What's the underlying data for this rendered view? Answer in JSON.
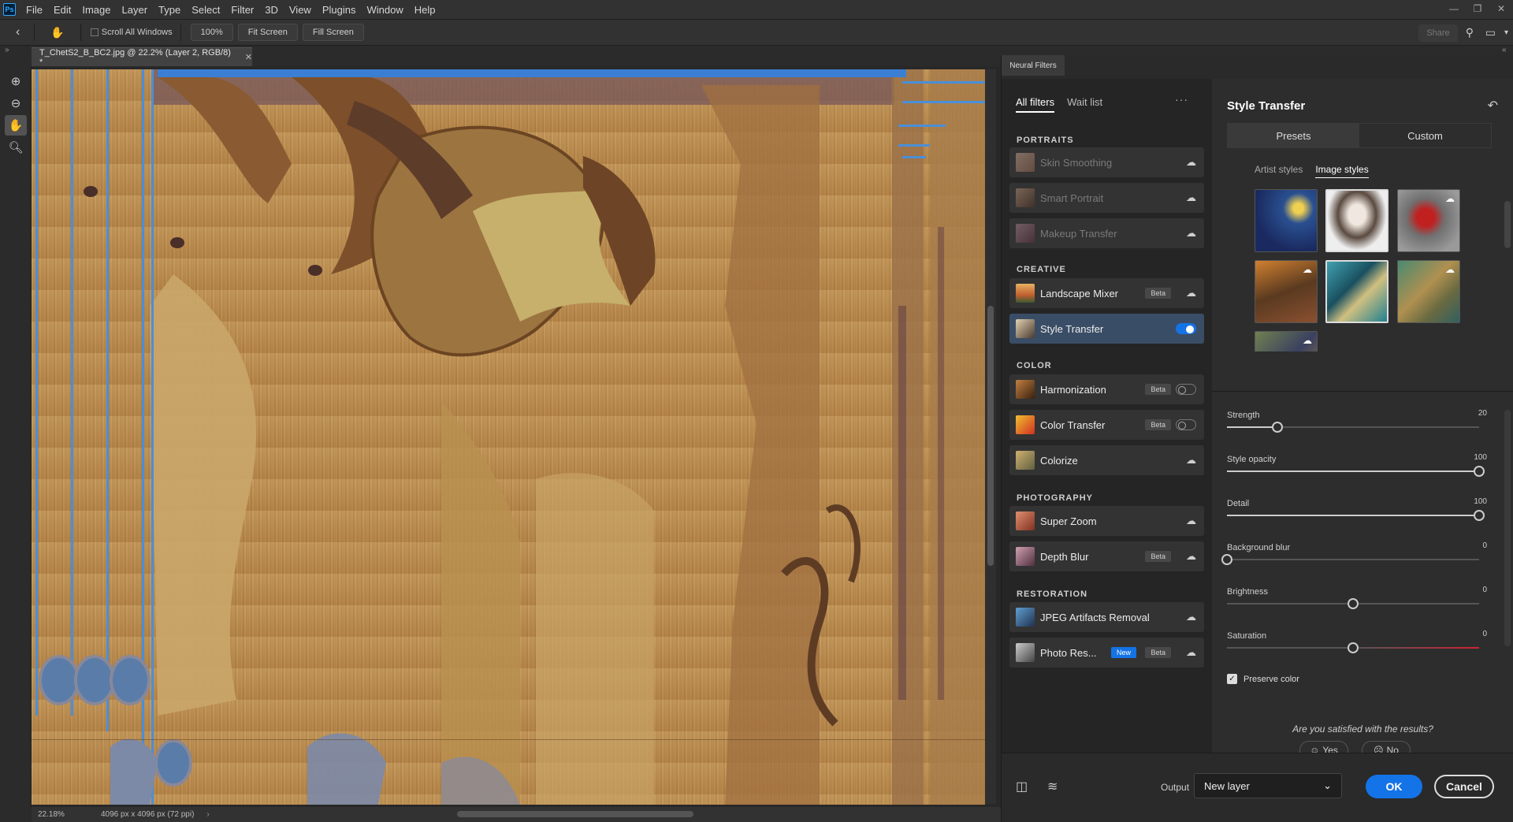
{
  "app": {
    "logo": "Ps"
  },
  "menu": [
    "File",
    "Edit",
    "Image",
    "Layer",
    "Type",
    "Select",
    "Filter",
    "3D",
    "View",
    "Plugins",
    "Window",
    "Help"
  ],
  "options": {
    "scroll_all_windows": "Scroll All Windows",
    "zoom_level": "100%",
    "fit_screen": "Fit Screen",
    "fill_screen": "Fill Screen",
    "share": "Share"
  },
  "document": {
    "tab_title": "T_ChetS2_B_BC2.jpg @ 22.2% (Layer 2, RGB/8) *",
    "zoom": "22.18%",
    "dimensions": "4096 px x 4096 px (72 ppi)"
  },
  "neural_filters": {
    "panel_tab": "Neural Filters",
    "tabs": [
      "All filters",
      "Wait list"
    ],
    "sections": {
      "portraits": "PORTRAITS",
      "creative": "CREATIVE",
      "color": "COLOR",
      "photography": "PHOTOGRAPHY",
      "restoration": "RESTORATION"
    },
    "filters": {
      "skin_smoothing": "Skin Smoothing",
      "smart_portrait": "Smart Portrait",
      "makeup_transfer": "Makeup Transfer",
      "landscape_mixer": "Landscape Mixer",
      "style_transfer": "Style Transfer",
      "harmonization": "Harmonization",
      "color_transfer": "Color Transfer",
      "colorize": "Colorize",
      "super_zoom": "Super Zoom",
      "depth_blur": "Depth Blur",
      "jpeg_artifacts": "JPEG Artifacts Removal",
      "photo_restoration": "Photo Res..."
    },
    "badges": {
      "beta": "Beta",
      "new": "New"
    }
  },
  "style_transfer": {
    "title": "Style Transfer",
    "segments": [
      "Presets",
      "Custom"
    ],
    "subtabs": [
      "Artist styles",
      "Image styles"
    ],
    "sliders": {
      "strength": {
        "label": "Strength",
        "value": "20",
        "level": 0.2
      },
      "style_opacity": {
        "label": "Style opacity",
        "value": "100",
        "level": 1.0
      },
      "detail": {
        "label": "Detail",
        "value": "100",
        "level": 1.0
      },
      "background_blur": {
        "label": "Background blur",
        "value": "0",
        "level": 0.0
      },
      "brightness": {
        "label": "Brightness",
        "value": "0",
        "level": 0.5
      },
      "saturation": {
        "label": "Saturation",
        "value": "0",
        "level": 0.5
      }
    },
    "preserve_color": "Preserve color",
    "question": "Are you satisfied with the results?",
    "yes": "Yes",
    "no": "No"
  },
  "footer": {
    "output_label": "Output",
    "output_value": "New layer",
    "ok": "OK",
    "cancel": "Cancel"
  }
}
